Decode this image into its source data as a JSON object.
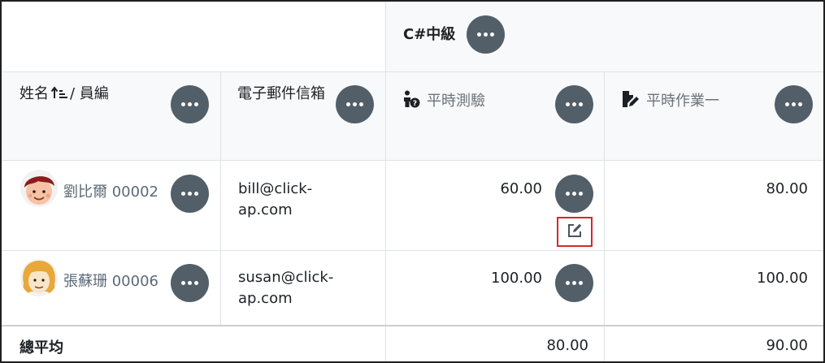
{
  "course": {
    "name": "C#中級"
  },
  "columns": {
    "name_prefix": "姓名",
    "name_suffix": "/ 員編",
    "email": "電子郵件信箱",
    "quiz": "平時測驗",
    "assignment": "平時作業一"
  },
  "students": [
    {
      "name": "劉比爾",
      "id": "00002",
      "email_line1": "bill@click-",
      "email_line2": "ap.com",
      "quiz": "60.00",
      "assignment": "80.00",
      "avatar": "boy-avatar"
    },
    {
      "name": "張蘇珊",
      "id": "00006",
      "email_line1": "susan@click-",
      "email_line2": "ap.com",
      "quiz": "100.00",
      "assignment": "100.00",
      "avatar": "girl-avatar"
    }
  ],
  "footer": {
    "label": "總平均",
    "quiz_avg": "80.00",
    "assignment_avg": "90.00"
  },
  "icons": {
    "menu": "ellipsis-icon",
    "sort": "sort-ascending-icon",
    "quiz": "person-question-icon",
    "assignment": "file-edit-icon",
    "edit": "edit-icon"
  },
  "colors": {
    "menu_button": "#525f69",
    "highlight": "#d9262c",
    "header_bg": "#f8f9fa"
  }
}
